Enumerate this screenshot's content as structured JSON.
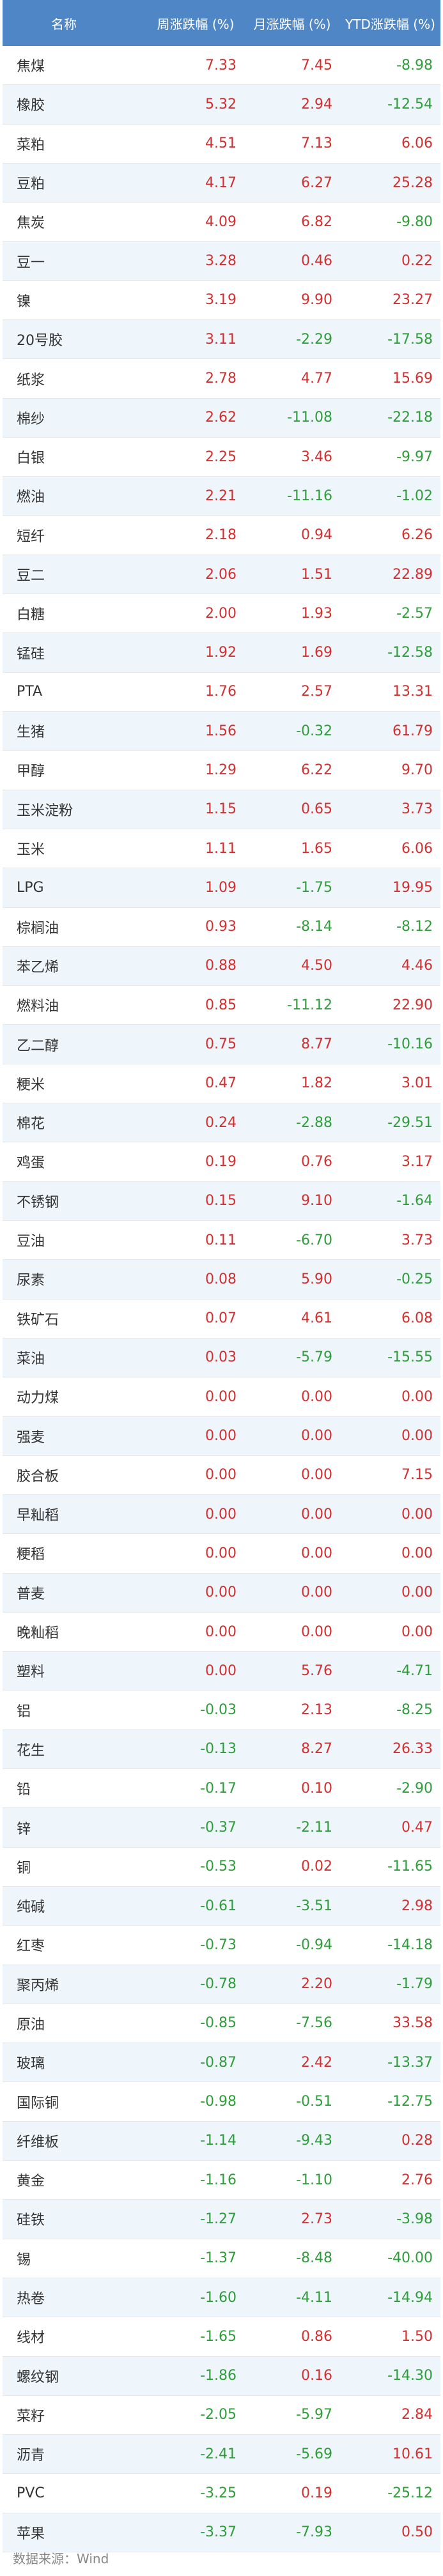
{
  "header": {
    "name": "名称",
    "week": "周涨跌幅 (%)",
    "month": "月涨跌幅 (%)",
    "ytd": "YTD涨跌幅 (%)"
  },
  "rows": [
    {
      "name": "焦煤",
      "w": "7.33",
      "m": "7.45",
      "y": "-8.98"
    },
    {
      "name": "橡胶",
      "w": "5.32",
      "m": "2.94",
      "y": "-12.54"
    },
    {
      "name": "菜粕",
      "w": "4.51",
      "m": "7.13",
      "y": "6.06"
    },
    {
      "name": "豆粕",
      "w": "4.17",
      "m": "6.27",
      "y": "25.28"
    },
    {
      "name": "焦炭",
      "w": "4.09",
      "m": "6.82",
      "y": "-9.80"
    },
    {
      "name": "豆一",
      "w": "3.28",
      "m": "0.46",
      "y": "0.22"
    },
    {
      "name": "镍",
      "w": "3.19",
      "m": "9.90",
      "y": "23.27"
    },
    {
      "name": "20号胶",
      "w": "3.11",
      "m": "-2.29",
      "y": "-17.58"
    },
    {
      "name": "纸浆",
      "w": "2.78",
      "m": "4.77",
      "y": "15.69"
    },
    {
      "name": "棉纱",
      "w": "2.62",
      "m": "-11.08",
      "y": "-22.18"
    },
    {
      "name": "白银",
      "w": "2.25",
      "m": "3.46",
      "y": "-9.97"
    },
    {
      "name": "燃油",
      "w": "2.21",
      "m": "-11.16",
      "y": "-1.02"
    },
    {
      "name": "短纤",
      "w": "2.18",
      "m": "0.94",
      "y": "6.26"
    },
    {
      "name": "豆二",
      "w": "2.06",
      "m": "1.51",
      "y": "22.89"
    },
    {
      "name": "白糖",
      "w": "2.00",
      "m": "1.93",
      "y": "-2.57"
    },
    {
      "name": "锰硅",
      "w": "1.92",
      "m": "1.69",
      "y": "-12.58"
    },
    {
      "name": "PTA",
      "w": "1.76",
      "m": "2.57",
      "y": "13.31"
    },
    {
      "name": "生猪",
      "w": "1.56",
      "m": "-0.32",
      "y": "61.79"
    },
    {
      "name": "甲醇",
      "w": "1.29",
      "m": "6.22",
      "y": "9.70"
    },
    {
      "name": "玉米淀粉",
      "w": "1.15",
      "m": "0.65",
      "y": "3.73"
    },
    {
      "name": "玉米",
      "w": "1.11",
      "m": "1.65",
      "y": "6.06"
    },
    {
      "name": "LPG",
      "w": "1.09",
      "m": "-1.75",
      "y": "19.95"
    },
    {
      "name": "棕榈油",
      "w": "0.93",
      "m": "-8.14",
      "y": "-8.12"
    },
    {
      "name": "苯乙烯",
      "w": "0.88",
      "m": "4.50",
      "y": "4.46"
    },
    {
      "name": "燃料油",
      "w": "0.85",
      "m": "-11.12",
      "y": "22.90"
    },
    {
      "name": "乙二醇",
      "w": "0.75",
      "m": "8.77",
      "y": "-10.16"
    },
    {
      "name": "粳米",
      "w": "0.47",
      "m": "1.82",
      "y": "3.01"
    },
    {
      "name": "棉花",
      "w": "0.24",
      "m": "-2.88",
      "y": "-29.51"
    },
    {
      "name": "鸡蛋",
      "w": "0.19",
      "m": "0.76",
      "y": "3.17"
    },
    {
      "name": "不锈钢",
      "w": "0.15",
      "m": "9.10",
      "y": "-1.64"
    },
    {
      "name": "豆油",
      "w": "0.11",
      "m": "-6.70",
      "y": "3.73"
    },
    {
      "name": "尿素",
      "w": "0.08",
      "m": "5.90",
      "y": "-0.25"
    },
    {
      "name": "铁矿石",
      "w": "0.07",
      "m": "4.61",
      "y": "6.08"
    },
    {
      "name": "菜油",
      "w": "0.03",
      "m": "-5.79",
      "y": "-15.55"
    },
    {
      "name": "动力煤",
      "w": "0.00",
      "m": "0.00",
      "y": "0.00"
    },
    {
      "name": "强麦",
      "w": "0.00",
      "m": "0.00",
      "y": "0.00"
    },
    {
      "name": "胶合板",
      "w": "0.00",
      "m": "0.00",
      "y": "7.15"
    },
    {
      "name": "早籼稻",
      "w": "0.00",
      "m": "0.00",
      "y": "0.00"
    },
    {
      "name": "粳稻",
      "w": "0.00",
      "m": "0.00",
      "y": "0.00"
    },
    {
      "name": "普麦",
      "w": "0.00",
      "m": "0.00",
      "y": "0.00"
    },
    {
      "name": "晚籼稻",
      "w": "0.00",
      "m": "0.00",
      "y": "0.00"
    },
    {
      "name": "塑料",
      "w": "0.00",
      "m": "5.76",
      "y": "-4.71"
    },
    {
      "name": "铝",
      "w": "-0.03",
      "m": "2.13",
      "y": "-8.25"
    },
    {
      "name": "花生",
      "w": "-0.13",
      "m": "8.27",
      "y": "26.33"
    },
    {
      "name": "铅",
      "w": "-0.17",
      "m": "0.10",
      "y": "-2.90"
    },
    {
      "name": "锌",
      "w": "-0.37",
      "m": "-2.11",
      "y": "0.47"
    },
    {
      "name": "铜",
      "w": "-0.53",
      "m": "0.02",
      "y": "-11.65"
    },
    {
      "name": "纯碱",
      "w": "-0.61",
      "m": "-3.51",
      "y": "2.98"
    },
    {
      "name": "红枣",
      "w": "-0.73",
      "m": "-0.94",
      "y": "-14.18"
    },
    {
      "name": "聚丙烯",
      "w": "-0.78",
      "m": "2.20",
      "y": "-1.79"
    },
    {
      "name": "原油",
      "w": "-0.85",
      "m": "-7.56",
      "y": "33.58"
    },
    {
      "name": "玻璃",
      "w": "-0.87",
      "m": "2.42",
      "y": "-13.37"
    },
    {
      "name": "国际铜",
      "w": "-0.98",
      "m": "-0.51",
      "y": "-12.75"
    },
    {
      "name": "纤维板",
      "w": "-1.14",
      "m": "-9.43",
      "y": "0.28"
    },
    {
      "name": "黄金",
      "w": "-1.16",
      "m": "-1.10",
      "y": "2.76"
    },
    {
      "name": "硅铁",
      "w": "-1.27",
      "m": "2.73",
      "y": "-3.98"
    },
    {
      "name": "锡",
      "w": "-1.37",
      "m": "-8.48",
      "y": "-40.00"
    },
    {
      "name": "热卷",
      "w": "-1.60",
      "m": "-4.11",
      "y": "-14.94"
    },
    {
      "name": "线材",
      "w": "-1.65",
      "m": "0.86",
      "y": "1.50"
    },
    {
      "name": "螺纹钢",
      "w": "-1.86",
      "m": "0.16",
      "y": "-14.30"
    },
    {
      "name": "菜籽",
      "w": "-2.05",
      "m": "-5.97",
      "y": "2.84"
    },
    {
      "name": "沥青",
      "w": "-2.41",
      "m": "-5.69",
      "y": "10.61"
    },
    {
      "name": "PVC",
      "w": "-3.25",
      "m": "0.19",
      "y": "-25.12"
    },
    {
      "name": "苹果",
      "w": "-3.37",
      "m": "-7.93",
      "y": "0.50"
    }
  ],
  "footer": {
    "source": "数据来源：Wind"
  },
  "colors": {
    "positive": "#d42f2f",
    "negative": "#2e9e3a",
    "header_bg": "#4f86c6"
  }
}
